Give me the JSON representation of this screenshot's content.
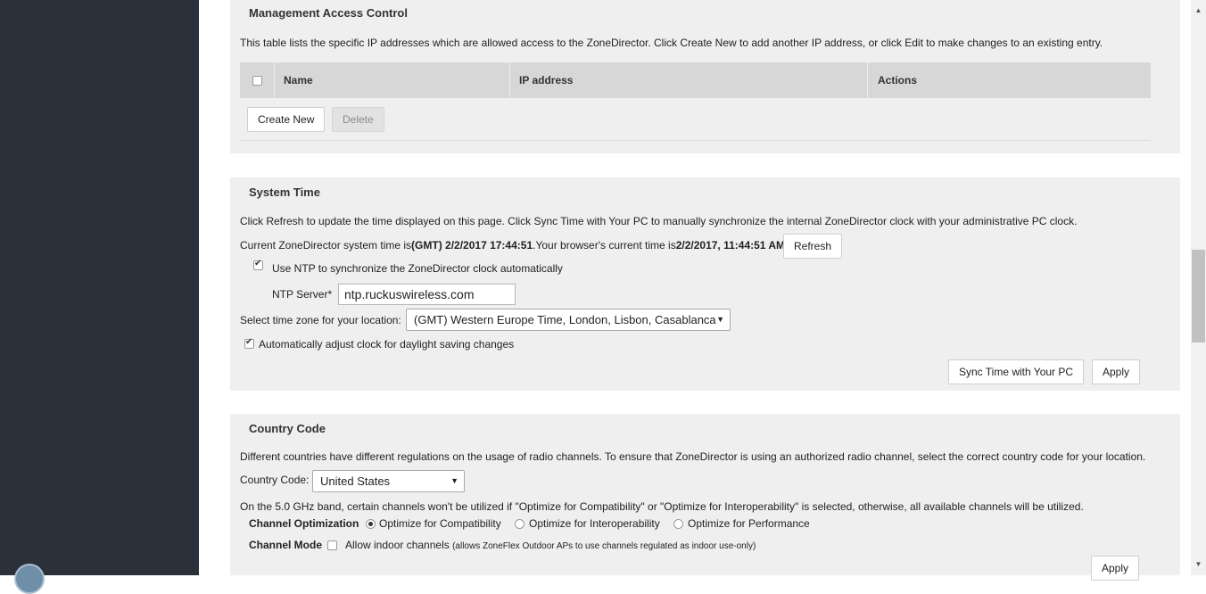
{
  "management": {
    "title": "Management Access Control",
    "description": "This table lists the specific IP addresses which are allowed access to the ZoneDirector. Click Create New to add another IP address, or click Edit to make changes to an existing entry.",
    "columns": [
      "Name",
      "IP address",
      "Actions"
    ],
    "create_label": "Create New",
    "delete_label": "Delete"
  },
  "system_time": {
    "title": "System Time",
    "description": "Click Refresh to update the time displayed on this page. Click Sync Time with Your PC to manually synchronize the internal ZoneDirector clock with your administrative PC clock.",
    "current_prefix": "Current ZoneDirector system time is",
    "current_value": "(GMT) 2/2/2017 17:44:51",
    "browser_prefix": ".Your browser's current time is",
    "browser_value": "2/2/2017, 11:44:51 AM",
    "refresh_label": "Refresh",
    "ntp_checkbox_label": "Use NTP to synchronize the ZoneDirector clock automatically",
    "ntp_server_label": "NTP Server*",
    "ntp_server_value": "ntp.ruckuswireless.com",
    "timezone_label": "Select time zone for your location:",
    "timezone_value": "(GMT) Western Europe Time, London, Lisbon, Casablanca",
    "dst_label": "Automatically adjust clock for daylight saving changes",
    "sync_label": "Sync Time with Your PC",
    "apply_label": "Apply"
  },
  "country": {
    "title": "Country Code",
    "description": "Different countries have different regulations on the usage of radio channels. To ensure that ZoneDirector is using an authorized radio channel, select the correct country code for your location.",
    "code_label": "Country Code:",
    "code_value": "United States",
    "note": "On the 5.0 GHz band, certain channels won't be utilized if \"Optimize for Compatibility\" or \"Optimize for Interoperability\" is selected, otherwise, all available channels will be utilized.",
    "optimization_label": "Channel Optimization",
    "options": [
      "Optimize for Compatibility",
      "Optimize for Interoperability",
      "Optimize for Performance"
    ],
    "selected_option": "Optimize for Compatibility",
    "mode_label": "Channel Mode",
    "indoor_label": "Allow indoor channels",
    "indoor_note": "(allows ZoneFlex Outdoor APs to use channels regulated as indoor use-only)",
    "apply_label": "Apply"
  },
  "colors": {
    "sidebar": "#2b313b",
    "panel": "#efefef",
    "table_header": "#d7d7d7"
  }
}
